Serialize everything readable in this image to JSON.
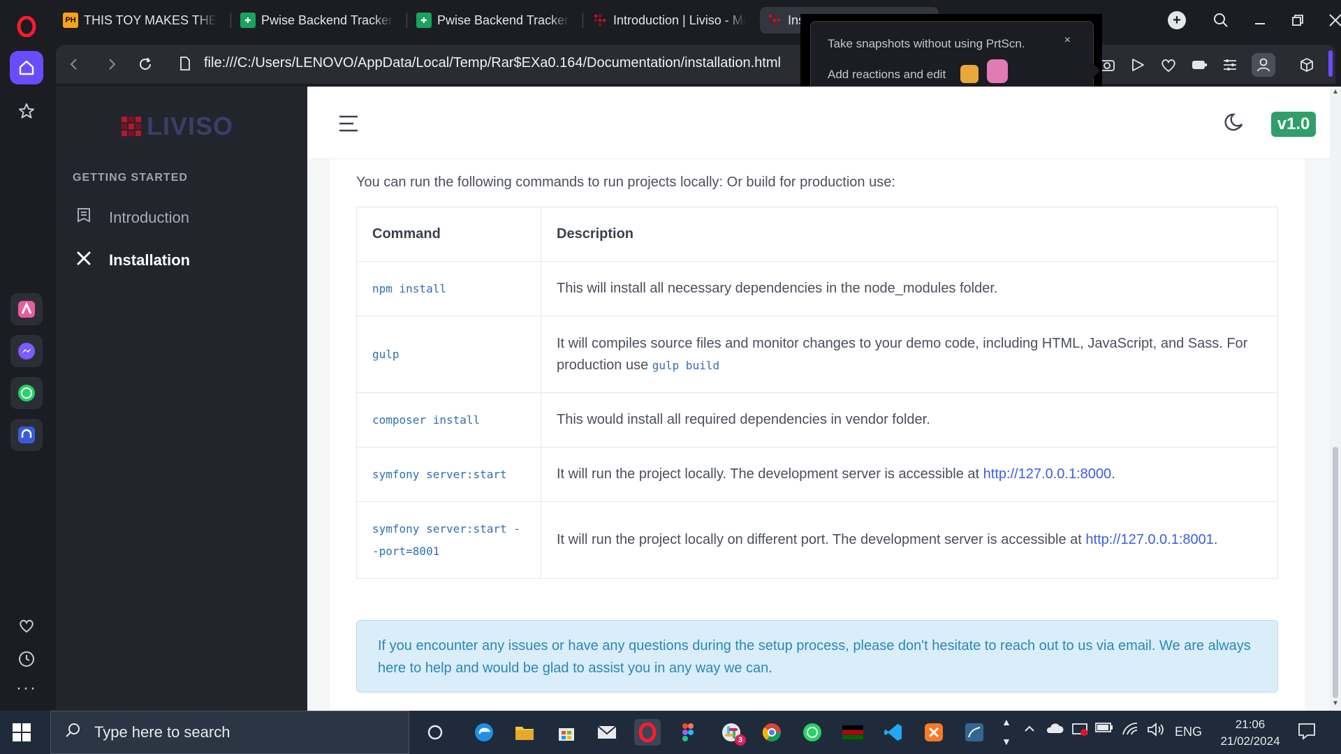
{
  "browser": {
    "tabs": [
      {
        "favicon": "PH",
        "title": "THIS TOY MAKES THE GOI"
      },
      {
        "favicon": "sheet",
        "title": "Pwise Backend Tracker - G"
      },
      {
        "favicon": "sheet",
        "title": "Pwise Backend Tracker - G"
      },
      {
        "favicon": "liviso",
        "title": "Introduction | Liviso - Mat"
      },
      {
        "favicon": "liviso",
        "title": "Ins"
      }
    ],
    "url": "file:///C:/Users/LENOVO/AppData/Local/Temp/Rar$EXa0.164/Documentation/installation.html",
    "accent": "#6a4cff"
  },
  "snapshot_popup": {
    "line1": "Take snapshots without using PrtScn.",
    "line2": "Add reactions and edit",
    "close": "×"
  },
  "docs": {
    "logo": "LIVISO",
    "section": "GETTING STARTED",
    "nav": [
      {
        "label": "Introduction",
        "icon": "document-icon"
      },
      {
        "label": "Installation",
        "icon": "tools-icon"
      }
    ],
    "version": "v1.0",
    "intro": "You can run the following commands to run projects locally: Or build for production use:",
    "table": {
      "headers": [
        "Command",
        "Description"
      ],
      "rows": [
        {
          "cmd": "npm install",
          "desc": "This will install all necessary dependencies in the node_modules folder."
        },
        {
          "cmd": "gulp",
          "desc": "It will compiles source files and monitor changes to your demo code, including HTML, JavaScript, and Sass. For production use ",
          "code": "gulp build"
        },
        {
          "cmd": "composer install",
          "desc": "This would install all required dependencies in vendor folder."
        },
        {
          "cmd": "symfony server:start",
          "desc": "It will run the project locally. The development server is accessible at ",
          "link": "http://127.0.0.1:8000",
          "after": "."
        },
        {
          "cmd": "symfony server:start --port=8001",
          "desc": "It will run the project locally on different port. The development server is accessible at ",
          "link": "http://127.0.0.1:8001",
          "after": "."
        }
      ]
    },
    "alert": "If you encounter any issues or have any questions during the setup process, please don't hesitate to reach out to us via email. We are always here to help and would be glad to assist you in any way we can.",
    "colors": {
      "link": "#3b5de7",
      "code": "#2e6fb3",
      "badge": "#2f9e6a",
      "alert_bg": "#d9eef9"
    }
  },
  "taskbar": {
    "search_placeholder": "Type here to search",
    "slack_badge": "3",
    "language": "ENG",
    "time": "21:06",
    "date": "21/02/2024"
  }
}
